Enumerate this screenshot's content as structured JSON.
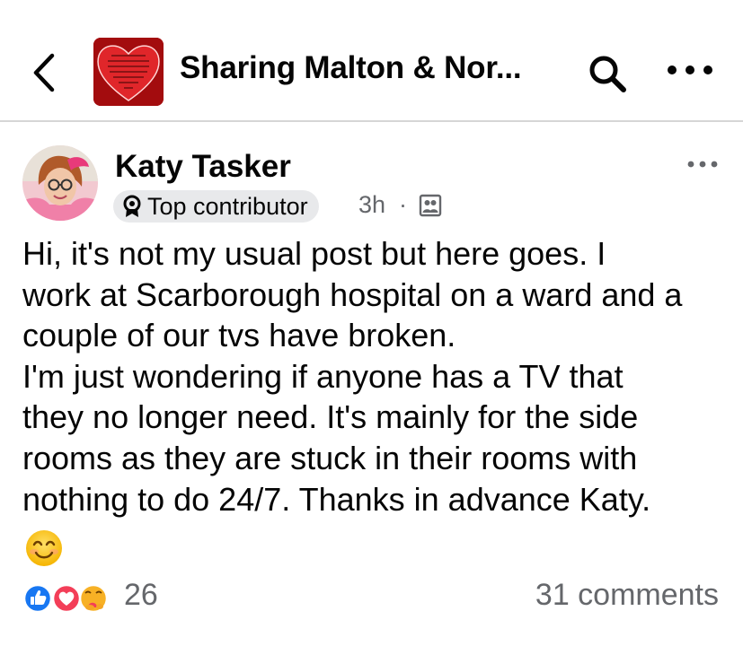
{
  "header": {
    "back_icon": "chevron-left-icon",
    "group_thumbnail": "heart-poem-thumbnail",
    "title": "Sharing Malton & Nor...",
    "search_icon": "search-icon",
    "more_icon": "more-horizontal-icon"
  },
  "post": {
    "author": "Katy Tasker",
    "badge": "Top contributor",
    "badge_icon": "ribbon-badge-icon",
    "time": "3h",
    "separator": "·",
    "audience_icon": "group-members-icon",
    "more_icon": "more-horizontal-icon",
    "body": "Hi, it's not my usual post but here goes. I\nwork at Scarborough hospital on a ward and a\ncouple of our tvs have broken.\nI'm just wondering if anyone has a TV that\nthey no longer need. It's mainly for the side\nrooms as they are stuck in their rooms with\nnothing to do 24/7. Thanks in advance Katy.",
    "emoji": "smiling-face-emoji"
  },
  "footer": {
    "reaction_icons": [
      "like-icon",
      "love-icon",
      "care-icon"
    ],
    "reaction_count": "26",
    "comments": "31 comments"
  },
  "colors": {
    "text": "#050505",
    "secondary": "#65676b",
    "like_blue": "#1877f2",
    "love_red": "#f33e58",
    "badge_bg": "#e8e9eb"
  }
}
